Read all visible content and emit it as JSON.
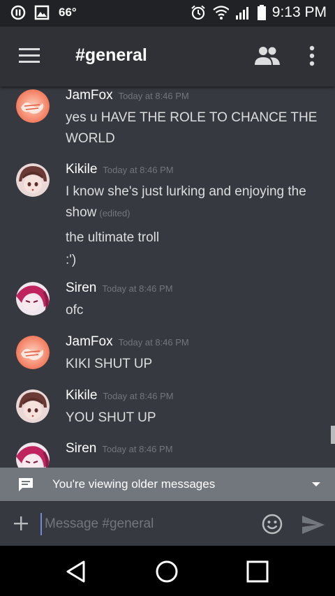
{
  "status_bar": {
    "temperature": "66°",
    "time": "9:13 PM",
    "icons": [
      "pause-circle-icon",
      "image-icon",
      "alarm-icon",
      "wifi-icon",
      "signal-icon",
      "battery-icon"
    ]
  },
  "toolbar": {
    "channel": "#general",
    "icons": [
      "menu-icon",
      "members-icon",
      "overflow-icon"
    ]
  },
  "messages": [
    {
      "author": "JamFox",
      "time": "Today at 8:46 PM",
      "lines": [
        "yes u HAVE THE ROLE TO CHANCE THE WORLD"
      ]
    },
    {
      "author": "Kikile",
      "time": "Today at 8:46 PM",
      "lines": [
        "I know she's just lurking and enjoying the show",
        "the ultimate troll",
        ":')"
      ],
      "edited": "(edited)"
    },
    {
      "author": "Siren",
      "time": "Today at 8:46 PM",
      "lines": [
        "ofc"
      ]
    },
    {
      "author": "JamFox",
      "time": "Today at 8:46 PM",
      "lines": [
        "KIKI SHUT UP"
      ]
    },
    {
      "author": "Kikile",
      "time": "Today at 8:46 PM",
      "lines": [
        "YOU SHUT UP"
      ]
    },
    {
      "author": "Siren",
      "time": "Today at 8:46 PM",
      "lines": []
    }
  ],
  "older_messages_bar": {
    "label": "You're viewing older messages"
  },
  "composer": {
    "placeholder": "Message #general"
  },
  "colors": {
    "background": "#36393f",
    "toolbar": "#2f3136",
    "status_bar": "#202225",
    "accent": "#7289da",
    "muted": "#72767d"
  }
}
